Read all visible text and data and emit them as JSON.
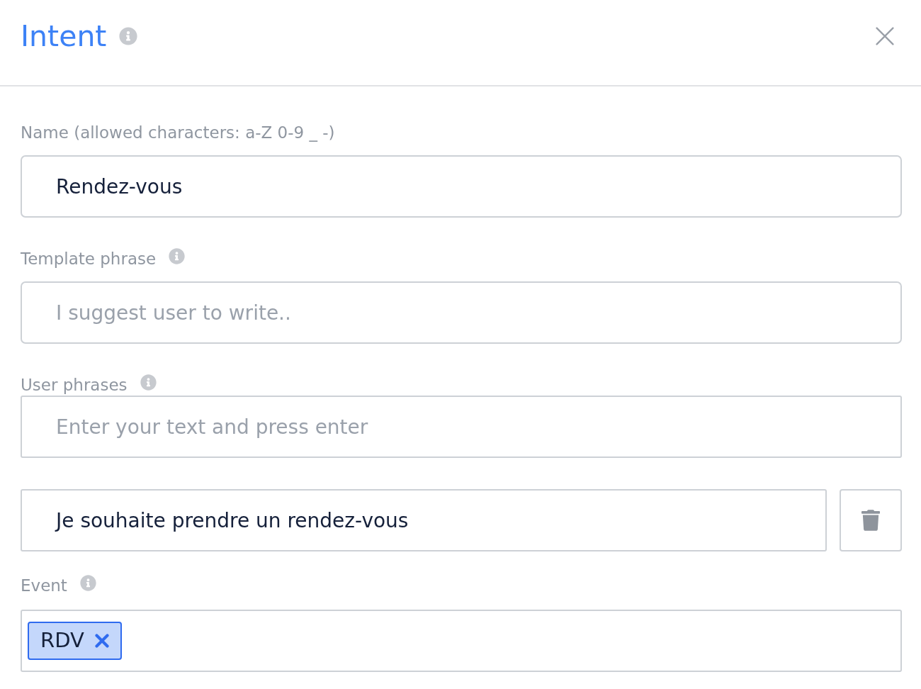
{
  "dialog": {
    "title": "Intent",
    "info": true
  },
  "fields": [
    {
      "kind": "text",
      "label": "Name (allowed characters: a-Z 0-9 _ -)",
      "value": "Rendez-vous"
    },
    {
      "kind": "text",
      "label": "Template phrase",
      "info": true,
      "placeholder": "I suggest user to write.."
    },
    {
      "kind": "phrases",
      "label": "User phrases",
      "info": true,
      "placeholder": "Enter your text and press enter",
      "phrases": [
        {
          "value": "Je souhaite prendre un rendez-vous"
        }
      ]
    },
    {
      "kind": "tags",
      "label": "Event",
      "info": true,
      "tags": [
        {
          "label": "RDV"
        }
      ]
    }
  ]
}
